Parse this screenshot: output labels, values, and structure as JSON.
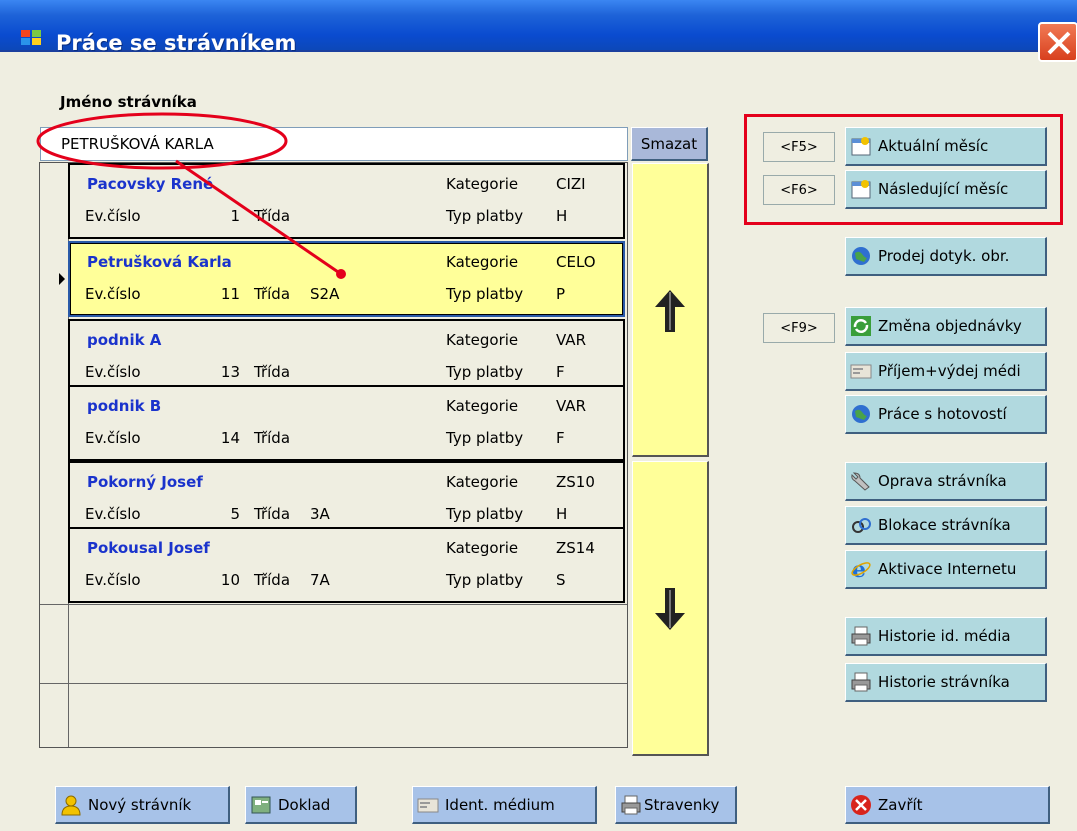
{
  "window": {
    "title": "Práce se strávníkem"
  },
  "search": {
    "label": "Jméno strávníka",
    "value": "PETRUŠKOVÁ KARLA",
    "clear_button": "Smazat"
  },
  "list": {
    "headers": {
      "category": "Kategorie",
      "ev_number": "Ev.číslo",
      "class": "Třída",
      "payment_type": "Typ platby"
    },
    "records": [
      {
        "name": "Pacovsky René",
        "ev": "1",
        "class": "",
        "category": "CIZI",
        "payment": "H"
      },
      {
        "name": "Petrušková Karla",
        "ev": "11",
        "class": "S2A",
        "category": "CELO",
        "payment": "P"
      },
      {
        "name": "podnik A",
        "ev": "13",
        "class": "",
        "category": "VAR",
        "payment": "F"
      },
      {
        "name": "podnik B",
        "ev": "14",
        "class": "",
        "category": "VAR",
        "payment": "F"
      },
      {
        "name": "Pokorný Josef",
        "ev": "5",
        "class": "3A",
        "category": "ZS10",
        "payment": "H"
      },
      {
        "name": "Pokousal Josef",
        "ev": "10",
        "class": "7A",
        "category": "ZS14",
        "payment": "S"
      }
    ]
  },
  "side": {
    "f5": "<F5>",
    "f6": "<F6>",
    "f9": "<F9>",
    "current_month": "Aktuální měsíc",
    "next_month": "Následující měsíc",
    "touch_sale": "Prodej dotyk. obr.",
    "order_change": "Změna objednávky",
    "media_issue": "Příjem+výdej médi",
    "cash_work": "Práce s hotovostí",
    "edit_diner": "Oprava strávníka",
    "block_diner": "Blokace strávníka",
    "internet_activation": "Aktivace Internetu",
    "media_history": "Historie id. média",
    "diner_history": "Historie strávníka"
  },
  "bottom": {
    "new_diner": "Nový strávník",
    "receipt": "Doklad",
    "ident_medium": "Ident. médium",
    "meal_tickets": "Stravenky",
    "close": "Zavřít"
  },
  "colors": {
    "annotation": "#e4001b",
    "selected_row": "#ffff99",
    "button": "#b1d9df",
    "title_bar": "#0a4bd0"
  }
}
